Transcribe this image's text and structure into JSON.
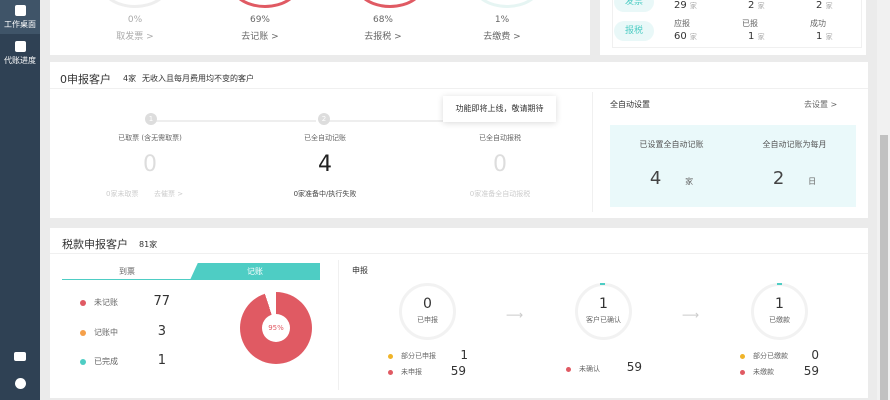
{
  "sidebar": {
    "items": [
      {
        "label": "工作桌面",
        "icon": "bar-chart-icon"
      },
      {
        "label": "代账进度",
        "icon": "document-icon"
      }
    ],
    "bottom_icons": [
      "download-monitor-icon",
      "headset-icon"
    ]
  },
  "progress": [
    {
      "pct": "0%",
      "link": "取发票 >"
    },
    {
      "pct": "69%",
      "link": "去记账 >"
    },
    {
      "pct": "68%",
      "link": "去报税 >"
    },
    {
      "pct": "1%",
      "link": "去缴费 >"
    }
  ],
  "summary": {
    "rows": [
      {
        "label": "发票",
        "values": [
          {
            "n": "29",
            "u": "家"
          },
          {
            "n": "2",
            "u": "家"
          },
          {
            "n": "2",
            "u": "家"
          }
        ]
      },
      {
        "label": "报税",
        "heads": [
          "应报",
          "已报",
          "成功"
        ],
        "values": [
          {
            "n": "60",
            "u": "家"
          },
          {
            "n": "1",
            "u": "家"
          },
          {
            "n": "1",
            "u": "家"
          }
        ]
      }
    ]
  },
  "zero": {
    "title": "0申报客户",
    "count": "4家",
    "desc": "无收入且每月费用均不变的客户",
    "tooltip": "功能即将上线，敬请期待",
    "steps": [
      {
        "num": "1",
        "label": "已取票 (含无需取票)",
        "value": "0",
        "sub": "0家未取票",
        "link": "去催票 >"
      },
      {
        "num": "2",
        "label": "已全自动记账",
        "value": "4",
        "sub": "0家准备中/执行失败"
      },
      {
        "label": "已全自动报税",
        "value": "0",
        "sub": "0家准备全自动报税"
      }
    ],
    "auto": {
      "title": "全自动设置",
      "link": "去设置 >",
      "boxes": [
        {
          "label": "已设置全自动记账",
          "value": "4",
          "unit": "家"
        },
        {
          "label": "全自动记账为每月",
          "value": "2",
          "unit": "日"
        }
      ]
    }
  },
  "tax": {
    "title": "税款申报客户",
    "count": "81家",
    "tabs": [
      "到票",
      "记账"
    ],
    "active_tab": 1,
    "legend": [
      {
        "label": "未记账",
        "value": "77",
        "color": "#e05a63"
      },
      {
        "label": "记账中",
        "value": "3",
        "color": "#f5a04a"
      },
      {
        "label": "已完成",
        "value": "1",
        "color": "#4ecdc4"
      }
    ],
    "pie_pct": "95%",
    "declare": {
      "title": "申报",
      "stages": [
        {
          "value": "0",
          "label": "已申报",
          "items": [
            {
              "label": "部分已申报",
              "value": "1",
              "color": "#f0b429"
            },
            {
              "label": "未申报",
              "value": "59",
              "color": "#e05a63"
            }
          ]
        },
        {
          "value": "1",
          "label": "客户已确认",
          "items": [
            {
              "label": "未确认",
              "value": "59",
              "color": "#e05a63"
            }
          ]
        },
        {
          "value": "1",
          "label": "已缴款",
          "items": [
            {
              "label": "部分已缴款",
              "value": "0",
              "color": "#f0b429"
            },
            {
              "label": "未缴款",
              "value": "59",
              "color": "#e05a63"
            }
          ]
        }
      ]
    }
  }
}
